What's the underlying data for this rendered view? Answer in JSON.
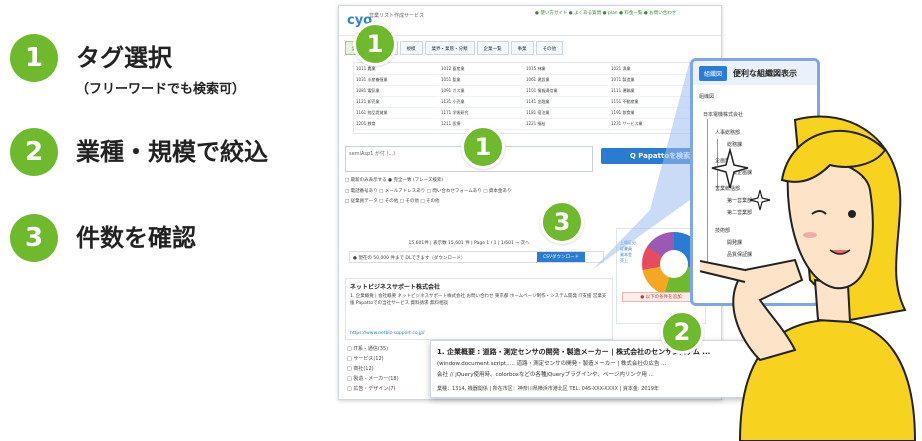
{
  "steps": [
    {
      "num": "1",
      "title": "タグ選択",
      "sub": "（フリーワードでも検索可）"
    },
    {
      "num": "2",
      "title": "業種・規模で絞込",
      "sub": ""
    },
    {
      "num": "3",
      "title": "件数を確認",
      "sub": ""
    }
  ],
  "screenshot": {
    "logo": "cyo",
    "logo_sub": "営業リスト作成サービス",
    "header_links": "● 使い方ガイド ● よくある質問 ● plan ● 料金一覧 ● お問い合わせ",
    "tabs": [
      "業種",
      "エリア",
      "規模",
      "業界・業態・分類",
      "企業一覧",
      "事業",
      "その他"
    ],
    "grid_cells": [
      "1011 農業",
      "1012 畜産業",
      "1015 林業",
      "1021 漁業",
      "1031 水産養殖業",
      "1051 鉱業",
      "1061 建設業",
      "1071 製造業",
      "1081 電気業",
      "1091 ガス業",
      "1101 情報通信業",
      "1111 運輸業",
      "1121 卸売業",
      "1131 小売業",
      "1141 金融業",
      "1151 不動産業",
      "1161 物品賃貸業",
      "1171 学術研究",
      "1181 宿泊業",
      "1191 飲食業",
      "1201 教育",
      "1211 医療",
      "1221 福祉",
      "1231 サービス業"
    ],
    "search_placeholder": "semiAsp1 が付 (...)",
    "search_button": "Q Papattoを検索",
    "option_rows": [
      "□ 最新のみ表示する   ● 完全一致 (フレーズ検索)",
      "□ 電話番号あり   □ メールアドレスあり   □ 問い合わせフォームあり   □ 資本金あり",
      "□ 従業員データ   □ その他   □ その他   □ その他"
    ],
    "count": "15,601件 | 表示数 15,601 件 | Page 1 / 1 | 1/601 → 次へ",
    "download_note": "● 現在の 50,000 件まで DLできます（ダウンロード）",
    "download_button": "CSVダウンロード",
    "result_title": "ネットビジネスサポート株式会社",
    "result_body": "1. 企業概要 | 会社概要 ネットビジネスサポート株式会社 お問い合わせ 東京都 ホームページ制作・システム開発 IT支援 営業支援 Papattoでの当社サービス 資料請求 無料相談",
    "result_url": "https://www.netbiz-support.co.jp/",
    "filters": [
      "□ IT系 - 通信(35)",
      "□ サービス(12)",
      "□ 商社(12)",
      "□ 製造 - メーカー(18)",
      "□ 広告・デザイン(7)",
      "□ 小売 - 飲食(11)"
    ],
    "overlay": {
      "l1": "1. 企業概要 : 道路・測定センサの開発・製造メーカー | 株式会社のセンサシステム ...",
      "l2": "(window.document.script,.... 道路・測定センサの開発・製造メーカー | 株式会社の広告 ...",
      "l3": "会社 // jQuery使用時、colorboxなどの各種jQueryプラグインや、ページ内リンク用 ...",
      "l4": "業種：1314, 機器関係 | 所在市区：神奈川県横浜市港北区 TEL: 045-XXX-XXXX | 資本金: 2019年"
    },
    "chart_legend": [
      "上場区分",
      "従業員",
      "資本金",
      "売上"
    ],
    "red_button": "● 以下の条件を追加"
  },
  "org": {
    "tag": "組織図",
    "title": "便利な組織図表示",
    "head": "組織図",
    "items": [
      "日本電機株式会社",
      "人事総務部",
      "総務課",
      "企画部",
      "事業企画課",
      "営業統括部",
      "第一営業部",
      "第二営業部",
      "技術部",
      "開発課",
      "品質保証課"
    ]
  },
  "colors": {
    "accent": "#6fba2c",
    "blue": "#2a7bd3",
    "panel_border": "#7fa7e6"
  },
  "badges": [
    "1",
    "1",
    "2",
    "3"
  ]
}
